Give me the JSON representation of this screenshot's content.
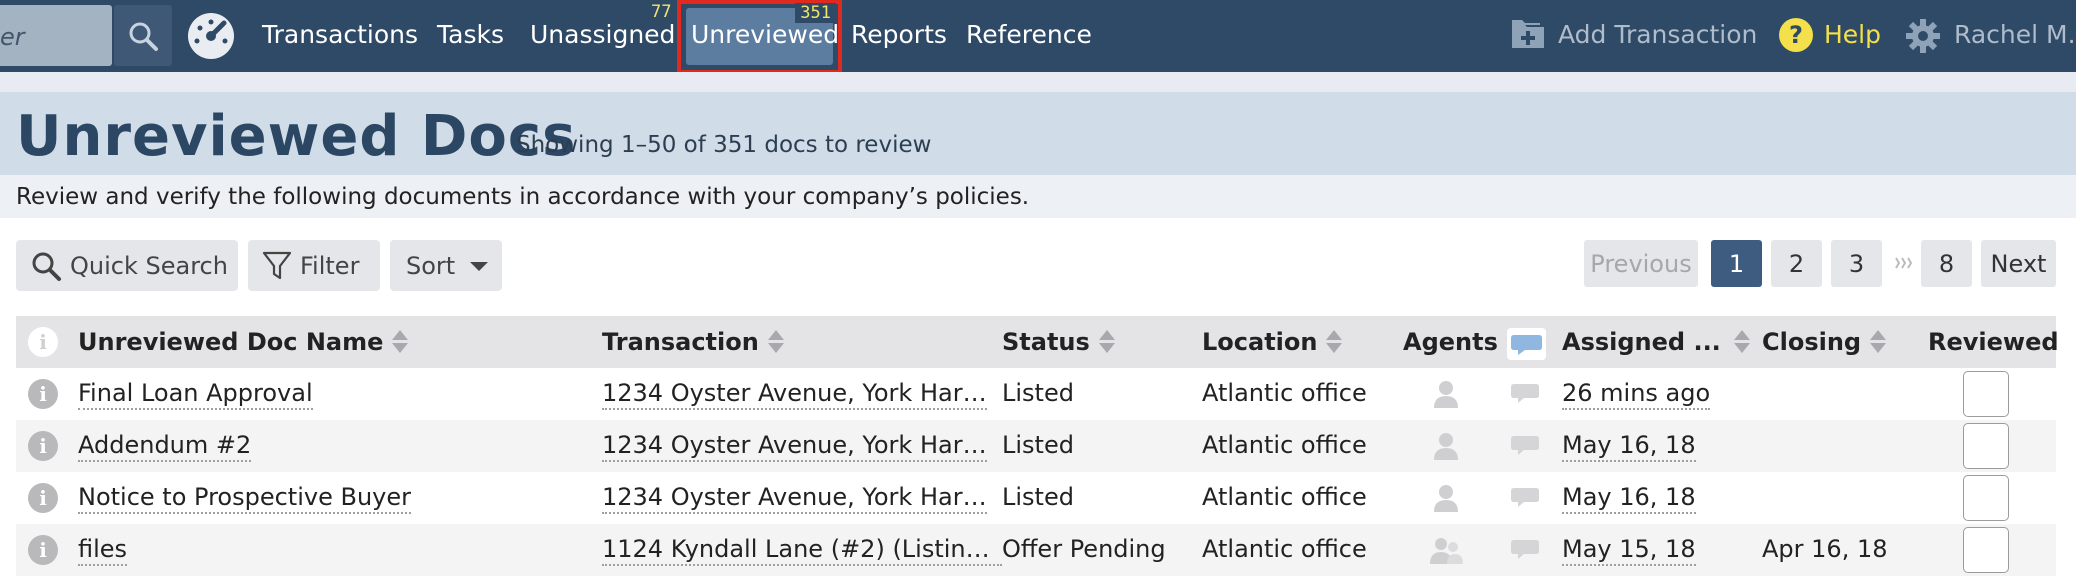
{
  "nav": {
    "search_partial": "er",
    "items": [
      {
        "label": "Transactions"
      },
      {
        "label": "Tasks"
      },
      {
        "label": "Unassigned",
        "badge": "77"
      },
      {
        "label": "Unreviewed",
        "badge": "351",
        "active": true
      },
      {
        "label": "Reports"
      },
      {
        "label": "Reference"
      }
    ],
    "add_transaction": "Add Transaction",
    "help": "Help",
    "user": "Rachel M."
  },
  "header": {
    "title": "Unreviewed Docs",
    "subtitle": "Showing 1–50 of 351 docs to review",
    "description": "Review and verify the following documents in accordance with your company’s policies."
  },
  "toolbar": {
    "quick_search": "Quick Search",
    "filter": "Filter",
    "sort": "Sort"
  },
  "pagination": {
    "previous": "Previous",
    "pages": [
      "1",
      "2",
      "3",
      "8"
    ],
    "current": "1",
    "next": "Next"
  },
  "table": {
    "columns": {
      "info": "i",
      "name": "Unreviewed Doc Name",
      "transaction": "Transaction",
      "status": "Status",
      "location": "Location",
      "agents": "Agents",
      "assigned": "Assigned ...",
      "closing": "Closing",
      "reviewed": "Reviewed"
    },
    "rows": [
      {
        "name": "Final Loan Approval",
        "transaction": "1234 Oyster Avenue, York Har…",
        "status": "Listed",
        "location": "Atlantic office",
        "agents": "single",
        "assigned": "26 mins ago",
        "closing": ""
      },
      {
        "name": "Addendum #2",
        "transaction": "1234 Oyster Avenue, York Har…",
        "status": "Listed",
        "location": "Atlantic office",
        "agents": "single",
        "assigned": "May 16, 18",
        "closing": ""
      },
      {
        "name": "Notice to Prospective Buyer",
        "transaction": "1234 Oyster Avenue, York Har…",
        "status": "Listed",
        "location": "Atlantic office",
        "agents": "single",
        "assigned": "May 16, 18",
        "closing": ""
      },
      {
        "name": "files",
        "transaction": "1124 Kyndall Lane (#2) (Listing…",
        "status": "Offer Pending",
        "location": "Atlantic office",
        "agents": "multiple",
        "assigned": "May 15, 18",
        "closing": "Apr 16, 18"
      }
    ]
  },
  "colors": {
    "nav_bg": "#2f4a66",
    "nav_active": "#5c7da0",
    "highlight_border": "#e02a1f",
    "badge": "#f1e66a",
    "help": "#f3e04a",
    "title": "#2c4764",
    "pagination_active": "#3e5c80"
  }
}
